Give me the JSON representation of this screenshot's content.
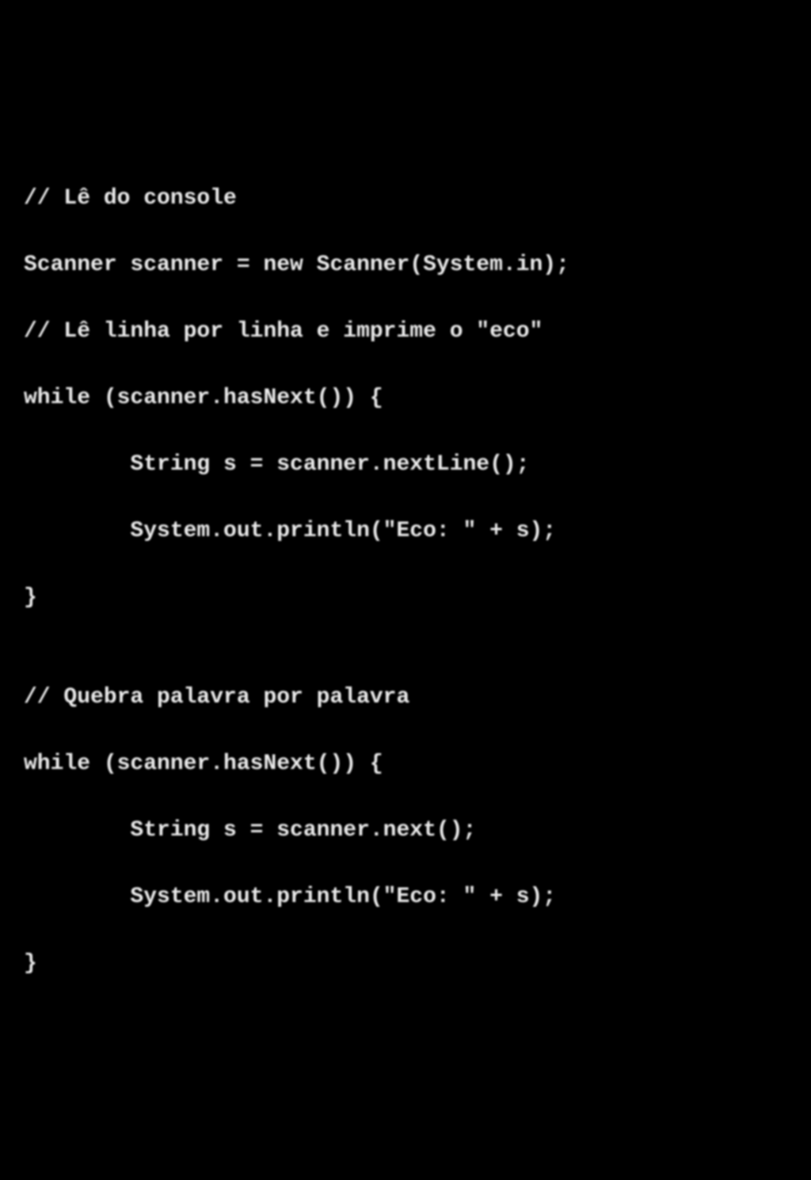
{
  "code": {
    "lines": [
      "// Lê do console",
      "Scanner scanner = new Scanner(System.in);",
      "// Lê linha por linha e imprime o \"eco\"",
      "while (scanner.hasNext()) {",
      "        String s = scanner.nextLine();",
      "        System.out.println(\"Eco: \" + s);",
      "}",
      "",
      "// Quebra palavra por palavra",
      "while (scanner.hasNext()) {",
      "        String s = scanner.next();",
      "        System.out.println(\"Eco: \" + s);",
      "}"
    ]
  }
}
